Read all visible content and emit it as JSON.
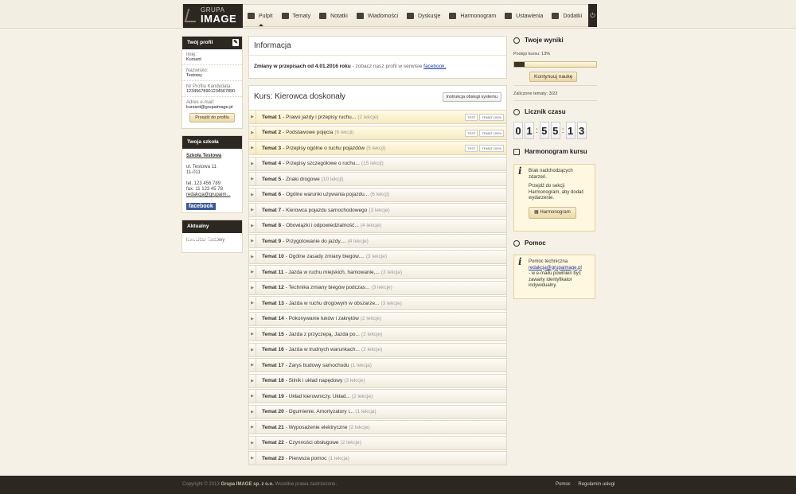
{
  "nav": {
    "logo_top": "GRUPA",
    "logo_bottom": "IMAGE",
    "items": [
      {
        "label": "Pulpit",
        "icon": "dashboard-icon"
      },
      {
        "label": "Tematy",
        "icon": "book-icon"
      },
      {
        "label": "Notatki",
        "icon": "notes-icon"
      },
      {
        "label": "Wiadomości",
        "icon": "envelope-icon"
      },
      {
        "label": "Dyskusje",
        "icon": "chat-icon"
      },
      {
        "label": "Harmonogram",
        "icon": "calendar-icon"
      },
      {
        "label": "Ustawienia",
        "icon": "settings-icon"
      },
      {
        "label": "Dodatki",
        "icon": "addons-icon"
      }
    ]
  },
  "profile": {
    "header": "Twój profil",
    "name_label": "Imię:",
    "name": "Kursant",
    "surname_label": "Nazwisko:",
    "surname": "Testowy",
    "candidate_label": "Nr Profilu Kandydata:",
    "candidate": "12345678901234567890",
    "email_label": "Adres e-mail:",
    "email": "kursant@grupaimage.pl",
    "button": "Przejdź do profilu"
  },
  "school": {
    "header": "Twoja szkoła",
    "name": "Szkoła Testowa",
    "street": "ul. Testowa 11",
    "city": "11-011",
    "tel": "tel. 123 456 789",
    "fax": "fax. 11 123 45 78",
    "email": "redakcja@grupaim...",
    "facebook": "facebook"
  },
  "lecturer": {
    "header": "Aktualny wykładowca",
    "name": "Instruktor Testowy"
  },
  "info": {
    "title": "Informacja",
    "bold": "Zmiany w przepisach od 4.01.2016 roku",
    "rest": " - zobacz nasz profil w serwisie ",
    "link": "facebook."
  },
  "course": {
    "title": "Kurs: Kierowca doskonały",
    "instr_button": "Instrukcja obsługi systemu",
    "badge_test": "TEST",
    "badge_topic": "TEMAT 100%",
    "topics": [
      {
        "num": "Temat 1",
        "title": " - Prawo jazdy i przepisy ruchu...",
        "count": "(2 lekcje)",
        "hl": true
      },
      {
        "num": "Temat 2",
        "title": " - Podstawowe pojęcia",
        "count": "(6 lekcji)",
        "hl": true
      },
      {
        "num": "Temat 3",
        "title": " - Przepisy ogólne o ruchu pojazdów",
        "count": "(5 lekcji)",
        "hl": true
      },
      {
        "num": "Temat 4",
        "title": " - Przepisy szczegółowe o ruchu...",
        "count": "(15 lekcji)"
      },
      {
        "num": "Temat 5",
        "title": " - Znaki drogowe",
        "count": "(10 lekcji)"
      },
      {
        "num": "Temat 6",
        "title": " - Ogólne warunki używania pojazdu...",
        "count": "(6 lekcji)"
      },
      {
        "num": "Temat 7",
        "title": " - Kierowca pojazdu samochodowego",
        "count": "(3 lekcje)"
      },
      {
        "num": "Temat 8",
        "title": " - Obowiązki i odpowiedzialność...",
        "count": "(4 lekcje)"
      },
      {
        "num": "Temat 9",
        "title": " - Przygotowanie do jazdy....",
        "count": "(4 lekcje)"
      },
      {
        "num": "Temat 10",
        "title": " - Ogólne zasady zmiany biegów....",
        "count": "(3 lekcje)"
      },
      {
        "num": "Temat 11",
        "title": " - Jazda w ruchu miejskich, hamowanie,...",
        "count": "(3 lekcje)"
      },
      {
        "num": "Temat 12",
        "title": " - Technika zmiany biegów podczas...",
        "count": "(3 lekcje)"
      },
      {
        "num": "Temat 13",
        "title": " - Jazda w ruchu drogowym w obszarze...",
        "count": "(3 lekcje)"
      },
      {
        "num": "Temat 14",
        "title": " - Pokonywanie łuków i zakrętów",
        "count": "(2 lekcje)"
      },
      {
        "num": "Temat 15",
        "title": " - Jazda z przyczepą, Jazda po...",
        "count": "(2 lekcje)"
      },
      {
        "num": "Temat 16",
        "title": " - Jazda w trudnych warunkach...",
        "count": "(2 lekcje)"
      },
      {
        "num": "Temat 17",
        "title": " - Zarys budowy samochodu",
        "count": "(1 lekcja)"
      },
      {
        "num": "Temat 18",
        "title": " - Silnik i układ napędowy",
        "count": "(3 lekcje)"
      },
      {
        "num": "Temat 19",
        "title": " - Układ kierowniczy. Układ...",
        "count": "(2 lekcje)"
      },
      {
        "num": "Temat 20",
        "title": " - Ogumienie. Amortyzatory i...",
        "count": "(1 lekcja)"
      },
      {
        "num": "Temat 21",
        "title": " - Wyposażenie elektryczne",
        "count": "(2 lekcje)"
      },
      {
        "num": "Temat 22",
        "title": " - Czynności obsługowe",
        "count": "(2 lekcje)"
      },
      {
        "num": "Temat 23",
        "title": " - Pierwsza pomoc",
        "count": "(1 lekcja)"
      }
    ]
  },
  "results": {
    "title": "Twoje wyniki",
    "progress_label": "Postęp kursu: 13%",
    "progress": 13,
    "continue_button": "Kontynuuj naukę",
    "completed": "Zaliczone tematy: 3/23"
  },
  "timer": {
    "title": "Licznik czasu",
    "digits": [
      "0",
      "1",
      "5",
      "5",
      "1",
      "3"
    ]
  },
  "schedule": {
    "title": "Harmonogram kursu",
    "msg1": "Brak nadchodzących zdarzeń.",
    "msg2": "Przejdź do sekcji Harmonogram, aby dodać wydarzenie.",
    "button": "Harmonogram"
  },
  "help": {
    "title": "Pomoc",
    "text1": "Pomoc techniczna",
    "email": "redakcja@grupaimage.pl",
    "text2": "- w e-mailu powinien być zawarty identyfikator indywidualny."
  },
  "footer": {
    "copy_pre": "Copyright © 2013 ",
    "company": "Grupa IMAGE sp. z o.o.",
    "copy_post": " Wszelkie prawa zastrzeżone.",
    "link1": "Pomoc",
    "link2": "Regulamin usługi"
  }
}
